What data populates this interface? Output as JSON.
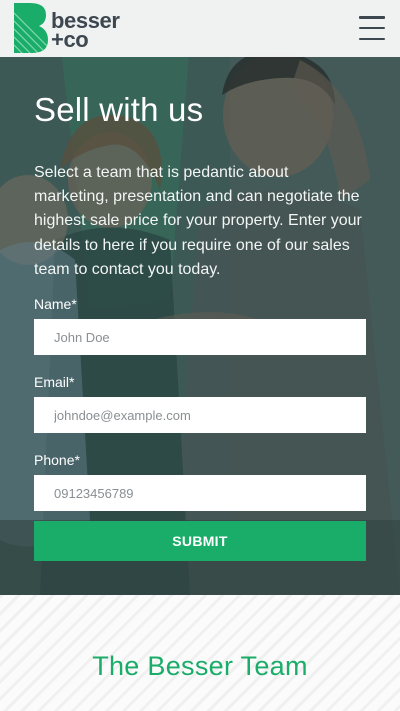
{
  "header": {
    "logo": {
      "line1": "besser",
      "line2": "+co"
    },
    "menu_icon": "hamburger-menu-icon"
  },
  "hero": {
    "title": "Sell with us",
    "description": "Select a team that is pedantic about marketing, presentation and can negotiate the highest sale price for your property. Enter your details to here if you require one of our sales team to contact you today.",
    "form": {
      "name_label": "Name*",
      "name_placeholder": "John Doe",
      "email_label": "Email*",
      "email_placeholder": "johndoe@example.com",
      "phone_label": "Phone*",
      "phone_placeholder": "09123456789",
      "submit_label": "SUBMIT"
    }
  },
  "team_section": {
    "title": "The Besser Team"
  },
  "colors": {
    "accent_green": "#1aad69",
    "logo_dark": "#3c4750",
    "white": "#ffffff"
  }
}
